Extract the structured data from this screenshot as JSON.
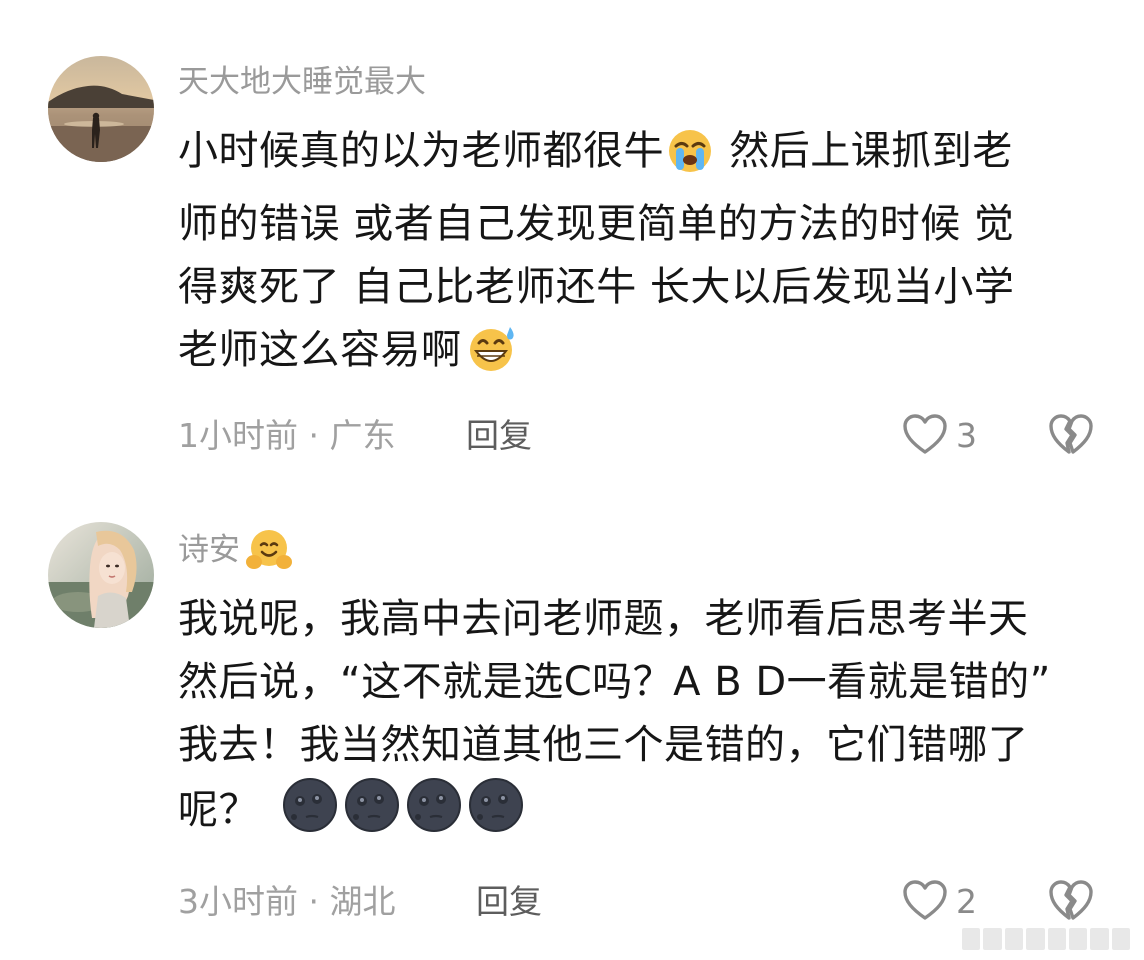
{
  "comments": [
    {
      "username": "天大地大睡觉最大",
      "lines": [
        [
          "小时候真的以为老师都很牛",
          "  然后上课抓到老"
        ],
        [
          "师的错误  或者自己发现更简单的方法的时候  觉"
        ],
        [
          "得爽死了  自己比老师还牛   长大以后发现当小学"
        ],
        [
          "老师这么容易啊"
        ]
      ],
      "emojis": [
        "loudly-crying-face",
        "grinning-face-with-sweat"
      ],
      "meta": "1小时前 · 广东",
      "reply_label": "回复",
      "like_count": "3"
    },
    {
      "username": "诗安",
      "username_emoji": "hugging-face",
      "lines": [
        [
          "我说呢，我高中去问老师题，老师看后思考半天"
        ],
        [
          "然后说，“这不就是选C吗？A B D一看就是错的”"
        ],
        [
          "我去！我当然知道其他三个是错的，它们错哪了"
        ],
        [
          "呢？"
        ]
      ],
      "emojis": [
        "new-moon-face",
        "new-moon-face",
        "new-moon-face",
        "new-moon-face"
      ],
      "meta": "3小时前 · 湖北",
      "reply_label": "回复",
      "like_count": "2"
    }
  ],
  "colors": {
    "username": "#9a9a9a",
    "body": "#161616",
    "meta": "#a0a0a0",
    "reply": "#5d5d5d",
    "icon": "#8a8a8a"
  }
}
